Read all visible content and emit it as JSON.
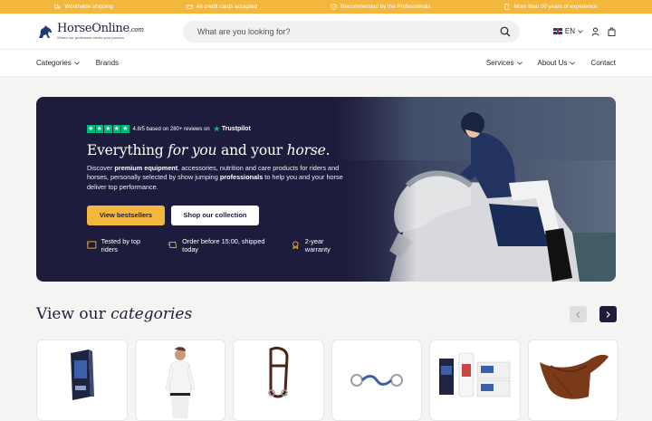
{
  "topbar": {
    "items": [
      {
        "label": "Worldwide shipping",
        "icon": "truck-icon"
      },
      {
        "label": "All credit cards accepted",
        "icon": "credit-card-icon"
      },
      {
        "label": "Recommended by the Professionals",
        "icon": "shield-icon"
      },
      {
        "label": "More then 50 years of experience",
        "icon": "award-icon"
      }
    ]
  },
  "header": {
    "logo_name": "HorseOnline",
    "logo_suffix": ".com",
    "logo_tagline": "Where our profession meets your passion",
    "search_placeholder": "What are you looking for?",
    "language": "EN"
  },
  "nav": {
    "left": [
      "Categories",
      "Brands"
    ],
    "right": [
      "Services",
      "About Us",
      "Contact"
    ]
  },
  "hero": {
    "rating_text": "4.8/5 based on 280+ reviews on",
    "trustpilot": "Trustpilot",
    "title_a": "Everything ",
    "title_b": "for you",
    "title_c": " and your ",
    "title_d": "horse",
    "title_e": ".",
    "desc_1": "Discover ",
    "desc_2": "premium equipment",
    "desc_3": ", accessories, nutrition and care products for riders and horses, personally selected by show jumping ",
    "desc_4": "professionals",
    "desc_5": " to help you and your horse deliver top performance.",
    "btn_primary": "View bestsellers",
    "btn_secondary": "Shop our collection",
    "usps": [
      "Tested by top riders",
      "Order before 15:00, shipped today",
      "2-year warranty"
    ]
  },
  "categories": {
    "title_a": "View our ",
    "title_b": "categories",
    "cards": [
      "horse-care-product",
      "rider-apparel",
      "bridle",
      "horse-bit",
      "supplements",
      "saddle"
    ]
  },
  "colors": {
    "accent": "#f2b73c",
    "navy": "#1e1c3c",
    "trustpilot": "#00b67a"
  }
}
